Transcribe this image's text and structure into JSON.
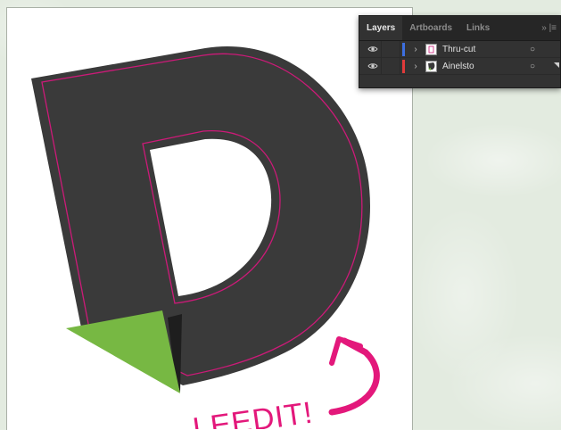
{
  "panel": {
    "tabs": [
      {
        "label": "Layers",
        "active": true
      },
      {
        "label": "Artboards",
        "active": false
      },
      {
        "label": "Links",
        "active": false
      }
    ],
    "overflow_label": "»",
    "menu_label": "|≡",
    "layers": [
      {
        "name": "Thru-cut",
        "color": "#3d6fe0",
        "visibility_icon": "eye-icon",
        "expand_icon": "chevron-right-icon",
        "target_glyph": "○"
      },
      {
        "name": "Ainelsto",
        "color": "#e03a3a",
        "visibility_icon": "eye-icon",
        "expand_icon": "chevron-right-icon",
        "target_glyph": "○"
      }
    ]
  },
  "canvas": {
    "annotation_text": "LEEDIT!",
    "colors": {
      "letter_fill": "#3a3a3a",
      "cut_line": "#cc1a78",
      "triangle": "#77b843",
      "arrow": "#e3187b",
      "artboard": "#ffffff"
    }
  }
}
